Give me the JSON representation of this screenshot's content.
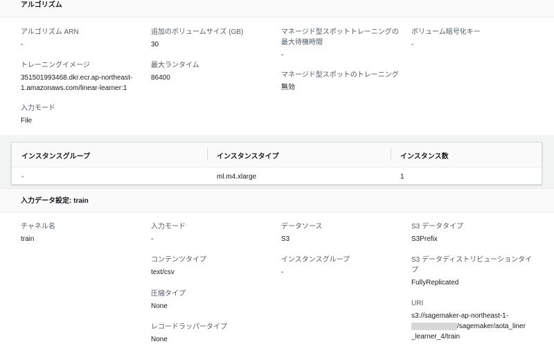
{
  "algorithm": {
    "header": "アルゴリズム",
    "fields": {
      "arn": {
        "label": "アルゴリズム ARN",
        "value": "-"
      },
      "volume_size": {
        "label": "追加のボリュームサイズ (GB)",
        "value": "30"
      },
      "max_wait_line1": "マネージド型スポットトレーニングの",
      "max_wait_line2": "最大待機時間",
      "max_wait_value": "-",
      "encryption_key": {
        "label": "ボリューム暗号化キー",
        "value": "-"
      },
      "training_image": {
        "label": "トレーニングイメージ",
        "value_line1": "351501993468.dkr.ecr.ap-northeast-",
        "value_line2": "1.amazonaws.com/linear-learner:1"
      },
      "max_runtime": {
        "label": "最大ランタイム",
        "value": "86400"
      },
      "spot_training": {
        "label": "マネージド型スポットのトレーニング",
        "value": "無効"
      },
      "input_mode": {
        "label": "入力モード",
        "value": "File"
      }
    }
  },
  "instance_table": {
    "headers": [
      "インスタンスグループ",
      "インスタンスタイプ",
      "インスタンス数"
    ],
    "rows": [
      [
        "-",
        "ml.m4.xlarge",
        "1"
      ]
    ]
  },
  "input_data": {
    "header": "入力データ設定: train",
    "fields": {
      "channel_name": {
        "label": "チャネル名",
        "value": "train"
      },
      "input_mode": {
        "label": "入力モード",
        "value": "-"
      },
      "content_type": {
        "label": "コンテンツタイプ",
        "value": "text/csv"
      },
      "compression": {
        "label": "圧縮タイプ",
        "value": "None"
      },
      "record_wrapper": {
        "label": "レコードラッパータイプ",
        "value": "None"
      },
      "data_source": {
        "label": "データソース",
        "value": "S3"
      },
      "instance_group": {
        "label": "インスタンスグループ",
        "value": "-"
      },
      "s3_data_type": {
        "label": "S3 データタイプ",
        "value": "S3Prefix"
      },
      "s3_distribution_line1": "S3 データディストリビューションタイ",
      "s3_distribution_line2": "プ",
      "s3_distribution_value": "FullyReplicated",
      "uri": {
        "label": "URI",
        "line1": "s3://sagemaker-ap-northeast-1-",
        "line2": "/sagemaker/aota_liner",
        "line3": "_learner_4/train"
      }
    }
  }
}
